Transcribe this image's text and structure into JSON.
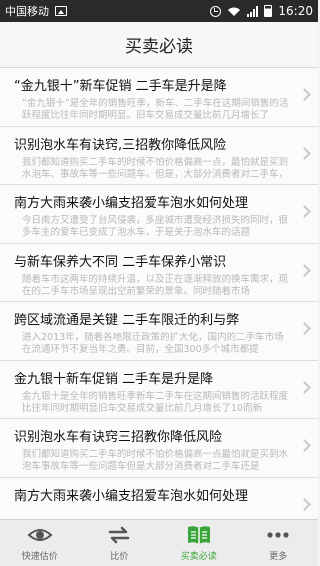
{
  "status_bar": {
    "carrier": "中国移动",
    "time": "16:20"
  },
  "header": {
    "title": "买卖必读"
  },
  "articles": [
    {
      "title": "“金九银十”新车促销 二手车是升是降",
      "summary": "“金九银十”是全年的销售旺季，新车、二手车在这期间销售的活跃程度比往年同时期明显。旧车交易成交量比前几月增长了"
    },
    {
      "title": "识别泡水车有诀窍,三招教你降低风险",
      "summary": "我们都知道购买二手车的时候不怕价格偏高一点，最怕就是买到水泡车、事故车等一些问题车。但是，大部分消费者对二手车，"
    },
    {
      "title": "南方大雨来袭小编支招爱车泡水如何处理",
      "summary": "今日南方又遭受了台风侵袭，多座城市遭受经济损失的同时，很多车主的爱车已变成了泡水车，于是关于泡水车的话题"
    },
    {
      "title": "与新车保养大不同 二手车保养小常识",
      "summary": "随着车市这两年的持续升温，以及正在逐渐释放的换车需求，现在的二手车市场呈现出空前繁荣的景象。同时随着市场"
    },
    {
      "title": "跨区域流通是关键 二手车限迁的利与弊",
      "summary": "进入2013年，随着各地限迁政策的扩大化，国内的二手车市场在流通环节不复当年之勇。目前，全国300多个城市都提"
    },
    {
      "title": "金九银十新车促销 二手车是升是降",
      "summary": "金九银十是全年的销售旺季新车二手车在这期间销售的活跃程度比往年同时期明显旧车交易成交量比前几月增长了10而新"
    },
    {
      "title": "识别泡水车有诀窍三招教你降低风险",
      "summary": "我们都知道购买二手车的时候不怕价格偏高一点最怕就是买到水泡车事故车等一些问题车但是大部分消费者对二手车还是"
    },
    {
      "title": "南方大雨来袭小编支招爱车泡水如何处理",
      "summary": ""
    }
  ],
  "tabbar": {
    "tabs": [
      {
        "label": "快速估价",
        "icon": "eye-icon"
      },
      {
        "label": "比价",
        "icon": "swap-icon"
      },
      {
        "label": "买卖必读",
        "icon": "book-icon",
        "active": true
      },
      {
        "label": "更多",
        "icon": "more-dots-icon"
      }
    ]
  },
  "colors": {
    "accent": "#3aa63a",
    "statusbar": "#2a2a2a"
  }
}
